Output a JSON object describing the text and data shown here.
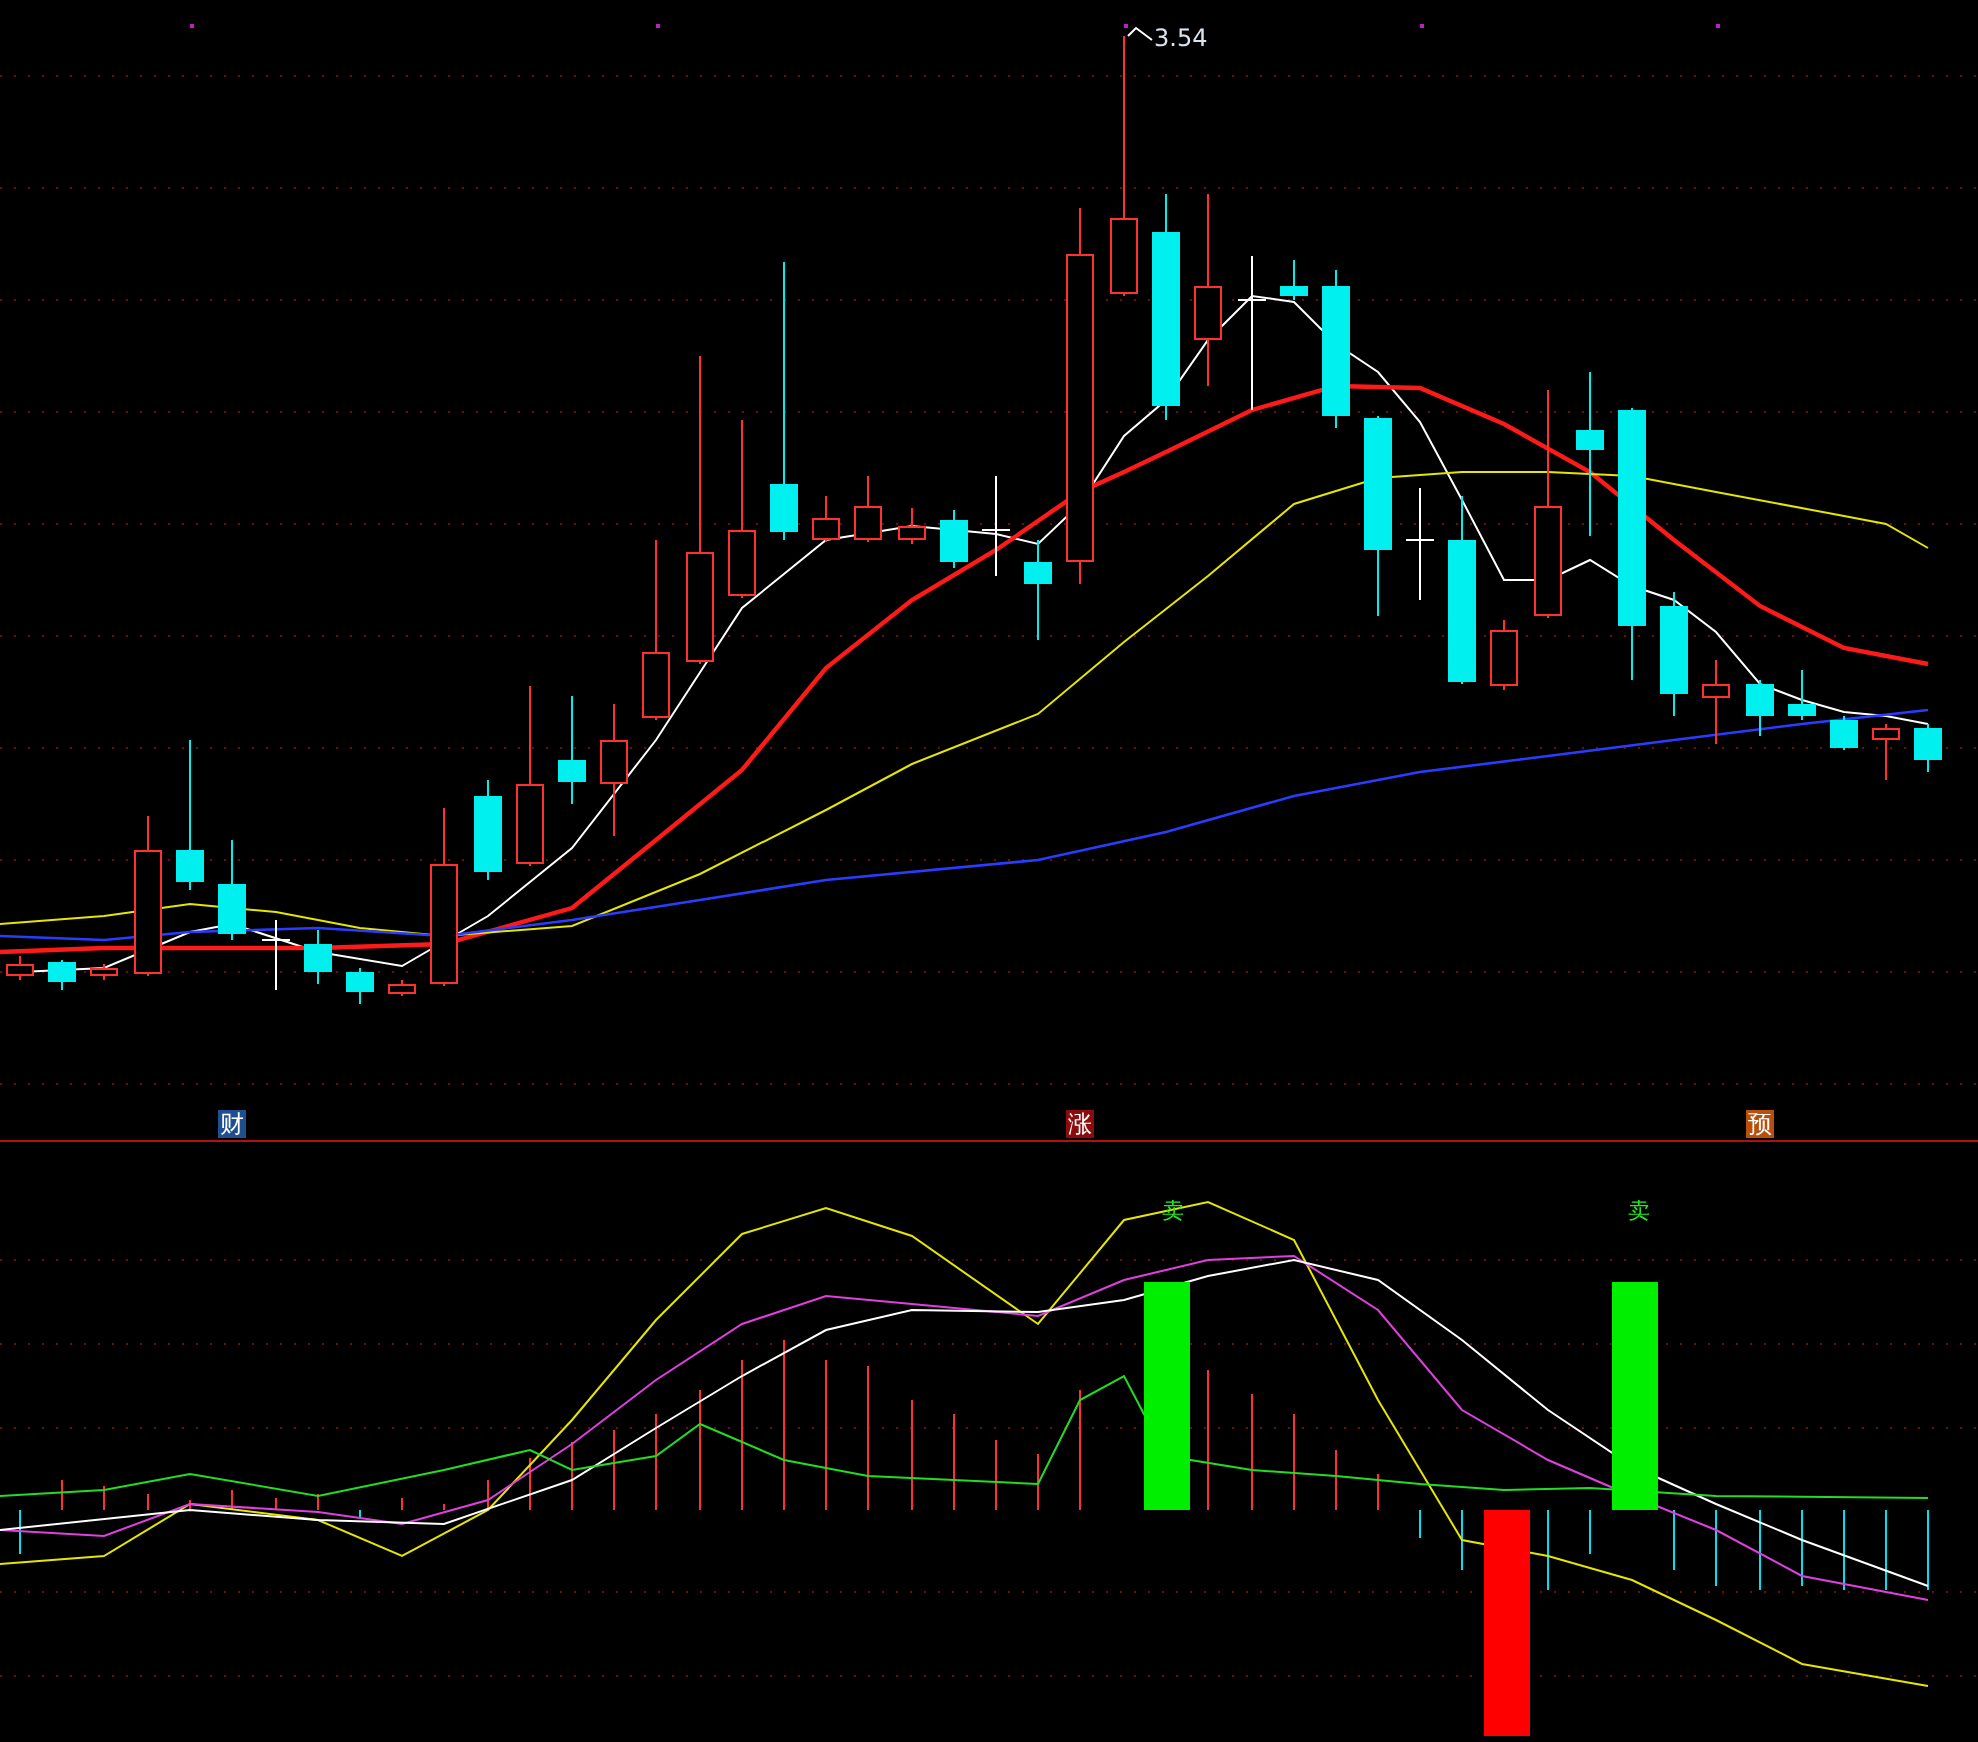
{
  "price_chart": {
    "high_price_label": "3.54"
  },
  "markers": [
    {
      "text": "财",
      "color": "#1f4f8f"
    },
    {
      "text": "涨",
      "color": "#8a0c0c"
    },
    {
      "text": "预",
      "color": "#b8500c"
    }
  ],
  "indicator_chart": {
    "signals": [
      {
        "text": "卖"
      },
      {
        "text": "卖"
      }
    ]
  }
}
